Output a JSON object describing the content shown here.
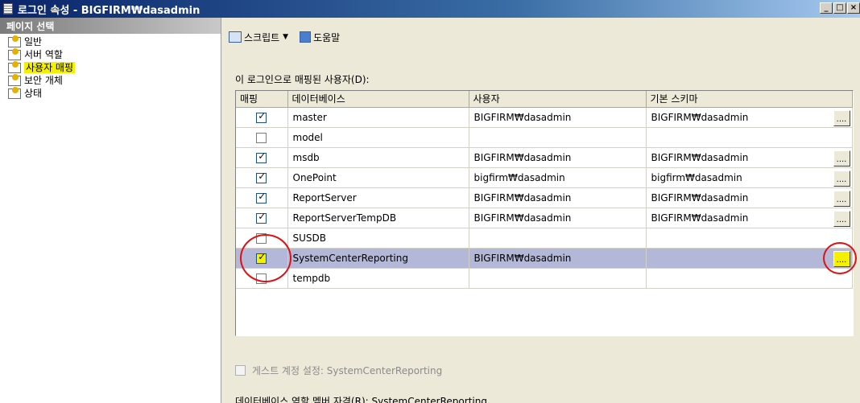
{
  "window": {
    "title": "로그인 속성 - BIGFIRM₩dasadmin",
    "controls": [
      "_",
      "□",
      "×"
    ]
  },
  "left_pane": {
    "header": "페이지 선택",
    "items": [
      {
        "label": "일반",
        "selected": false
      },
      {
        "label": "서버 역할",
        "selected": false
      },
      {
        "label": "사용자 매핑",
        "selected": true
      },
      {
        "label": "보안 개체",
        "selected": false
      },
      {
        "label": "상태",
        "selected": false
      }
    ]
  },
  "toolbar": {
    "script_label": "스크립트",
    "caret": "▼",
    "help_label": "도움말"
  },
  "mapping_label": "이 로그인으로 매핑된 사용자(D):",
  "grid": {
    "columns": [
      "매핑",
      "데이터베이스",
      "사용자",
      "기본 스키마"
    ],
    "ellipsis_label": "....",
    "rows": [
      {
        "mapped": true,
        "database": "master",
        "user": "BIGFIRM₩dasadmin",
        "schema": "BIGFIRM₩dasadmin",
        "has_button": true,
        "selected": false
      },
      {
        "mapped": false,
        "database": "model",
        "user": "",
        "schema": "",
        "has_button": false,
        "selected": false
      },
      {
        "mapped": true,
        "database": "msdb",
        "user": "BIGFIRM₩dasadmin",
        "schema": "BIGFIRM₩dasadmin",
        "has_button": true,
        "selected": false
      },
      {
        "mapped": true,
        "database": "OnePoint",
        "user": "bigfirm₩dasadmin",
        "schema": "bigfirm₩dasadmin",
        "has_button": true,
        "selected": false
      },
      {
        "mapped": true,
        "database": "ReportServer",
        "user": "BIGFIRM₩dasadmin",
        "schema": "BIGFIRM₩dasadmin",
        "has_button": true,
        "selected": false
      },
      {
        "mapped": true,
        "database": "ReportServerTempDB",
        "user": "BIGFIRM₩dasadmin",
        "schema": "BIGFIRM₩dasadmin",
        "has_button": true,
        "selected": false
      },
      {
        "mapped": false,
        "database": "SUSDB",
        "user": "",
        "schema": "",
        "has_button": false,
        "selected": false
      },
      {
        "mapped": true,
        "database": "SystemCenterReporting",
        "user": "BIGFIRM₩dasadmin",
        "schema": "",
        "has_button": true,
        "selected": true
      },
      {
        "mapped": false,
        "database": "tempdb",
        "user": "",
        "schema": "",
        "has_button": false,
        "selected": false
      }
    ]
  },
  "guest_label": "게스트 계정 설정: SystemCenterReporting",
  "role_label": "데이터베이스 역할 멤버 자격(R): SystemCenterReporting",
  "colors": {
    "highlight": "#f5f000",
    "selected_row": "#b4b8d8",
    "annotation": "#e01010"
  }
}
